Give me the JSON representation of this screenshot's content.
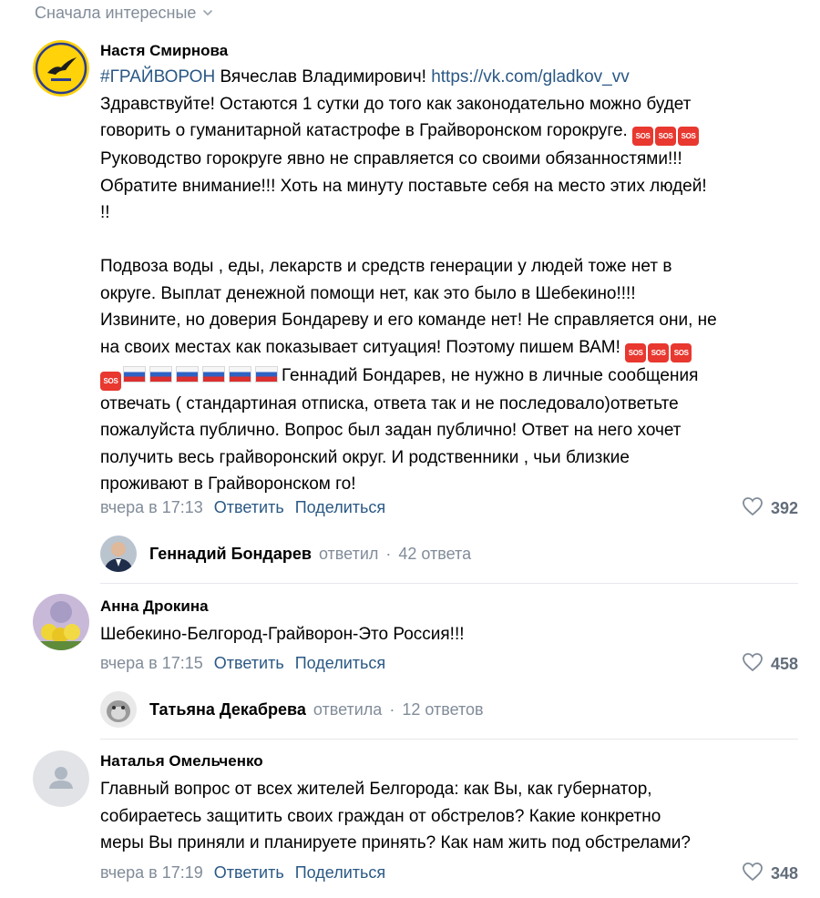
{
  "sort": {
    "label": "Сначала интересные"
  },
  "comments": [
    {
      "author": "Настя Смирнова",
      "hashtag": "#ГРАЙВОРОН",
      "addressee": " Вячеслав Владимирович! ",
      "link": "https://vk.com/gladkov_vv",
      "lines": [
        "Здравствуйте! Остаются 1 сутки до того как законодательно можно будет",
        "говорить о гуманитарной катастрофе в Грайворонском горокруге.",
        "Руководство горокруге явно не справляется со своими обязанностями!!!",
        "Обратите внимание!!! Хоть на минуту поставьте себя на место этих людей!",
        "!!",
        "",
        "Подвоза воды , еды, лекарств и средств генерации у людей тоже нет в",
        "округе. Выплат денежной помощи нет, как это было в Шебекино!!!!",
        "Извините, но доверия Бондареву и его команде нет! Не справляется они, не",
        "на своих местах как показывает ситуация! Поэтому пишем ВАМ!",
        "Геннадий Бондарев, не нужно в личные сообщения",
        "отвечать ( стандартиная отписка, ответа так и не последовало)ответьте",
        "пожалуйста публично. Вопрос был задан публично! Ответ на него хочет",
        "получить весь грайворонский округ. И родственники , чьи близкие",
        "проживают в Грайворонском го!"
      ],
      "sos_label": "SOS",
      "date": "вчера в 17:13",
      "reply_label": "Ответить",
      "share_label": "Поделиться",
      "likes": "392",
      "thread": {
        "name": "Геннадий Бондарев",
        "verb": "ответил",
        "dot": "·",
        "count": "42 ответа"
      }
    },
    {
      "author": "Анна Дрокина",
      "text": "Шебекино-Белгород-Грайворон-Это Россия!!!",
      "date": "вчера в 17:15",
      "reply_label": "Ответить",
      "share_label": "Поделиться",
      "likes": "458",
      "thread": {
        "name": "Татьяна Декабрева",
        "verb": "ответила",
        "dot": "·",
        "count": "12 ответов"
      }
    },
    {
      "author": "Наталья Омельченко",
      "lines": [
        "Главный вопрос от всех жителей Белгорода: как Вы, как губернатор,",
        "собираетесь защитить своих граждан от обстрелов? Какие конкретно",
        "меры Вы приняли и планируете принять? Как нам жить под обстрелами?"
      ],
      "date": "вчера в 17:19",
      "reply_label": "Ответить",
      "share_label": "Поделиться",
      "likes": "348"
    }
  ]
}
